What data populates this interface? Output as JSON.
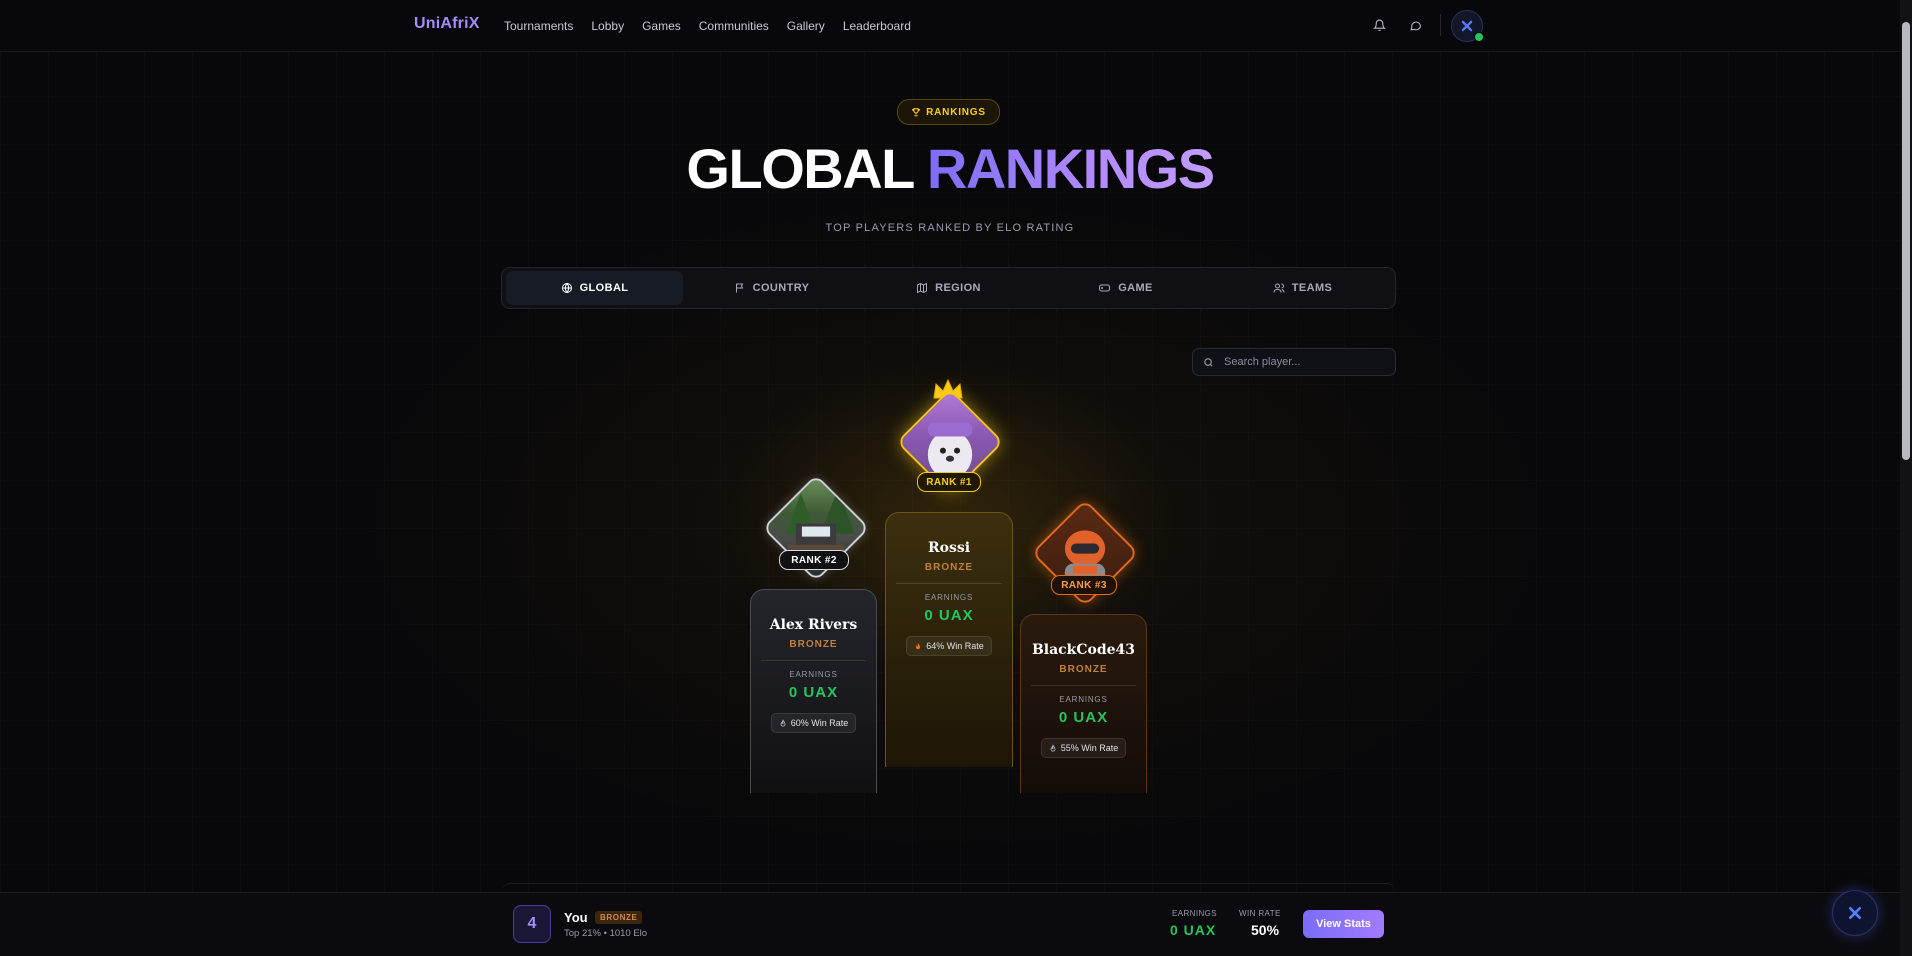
{
  "nav": {
    "brand": "UniAfriX",
    "links": [
      "Tournaments",
      "Lobby",
      "Games",
      "Communities",
      "Gallery",
      "Leaderboard"
    ],
    "icons": [
      "bell-icon",
      "chat-icon"
    ]
  },
  "hero": {
    "badge": "RANKINGS",
    "title_part1": "GLOBAL",
    "title_part2": "RANKINGS",
    "subtitle": "TOP PLAYERS RANKED BY ELO RATING"
  },
  "tabs": [
    {
      "label": "GLOBAL",
      "icon": "globe-icon",
      "active": true
    },
    {
      "label": "COUNTRY",
      "icon": "flag-icon",
      "active": false
    },
    {
      "label": "REGION",
      "icon": "map-icon",
      "active": false
    },
    {
      "label": "GAME",
      "icon": "gamepad-icon",
      "active": false
    },
    {
      "label": "TEAMS",
      "icon": "users-icon",
      "active": false
    }
  ],
  "search": {
    "placeholder": "Search player..."
  },
  "podium": {
    "first": {
      "rank": "RANK #1",
      "name": "Rossi",
      "tier": "BRONZE",
      "earnings_label": "EARNINGS",
      "earnings": "0  UAX",
      "win_rate": "64% Win Rate"
    },
    "second": {
      "rank": "RANK #2",
      "name": "Alex Rivers",
      "tier": "BRONZE",
      "earnings_label": "EARNINGS",
      "earnings": "0  UAX",
      "win_rate": "60% Win Rate"
    },
    "third": {
      "rank": "RANK #3",
      "name": "BlackCode43",
      "tier": "BRONZE",
      "earnings_label": "EARNINGS",
      "earnings": "0  UAX",
      "win_rate": "55% Win Rate"
    }
  },
  "me": {
    "rank": "4",
    "name": "You",
    "tier": "BRONZE",
    "sub": "Top 21% • 1010 Elo",
    "earnings_label": "EARNINGS",
    "earnings": "0  UAX",
    "winrate_label": "WIN RATE",
    "winrate": "50%",
    "button": "View Stats"
  },
  "colors": {
    "accent": "#a78bfa",
    "gold": "#facc15",
    "bronze": "#c2803d",
    "green": "#22c55e"
  }
}
